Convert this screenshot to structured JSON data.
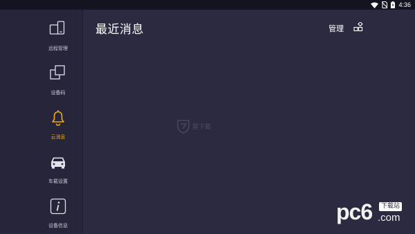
{
  "status_bar": {
    "time": "4:36",
    "icons": [
      "wifi-icon",
      "no-sim-icon",
      "battery-icon"
    ]
  },
  "sidebar": {
    "items": [
      {
        "label": "远程管理",
        "icon": "remote-devices-icon",
        "active": false
      },
      {
        "label": "设备码",
        "icon": "device-code-icon",
        "active": false
      },
      {
        "label": "云消息",
        "icon": "bell-icon",
        "active": true
      },
      {
        "label": "车载设置",
        "icon": "car-icon",
        "active": false
      },
      {
        "label": "设备信息",
        "icon": "info-icon",
        "active": false
      }
    ]
  },
  "main": {
    "title": "最近消息",
    "manage_label": "管理",
    "empty_state_text": "屋下载"
  },
  "watermark": {
    "brand": "pc6",
    "badge": "下载站",
    "suffix": ".com"
  },
  "colors": {
    "background": "#2b2a40",
    "sidebar": "#26253a",
    "statusbar": "#141420",
    "accent": "#f0a81c",
    "text_muted": "#c9c9d6"
  }
}
